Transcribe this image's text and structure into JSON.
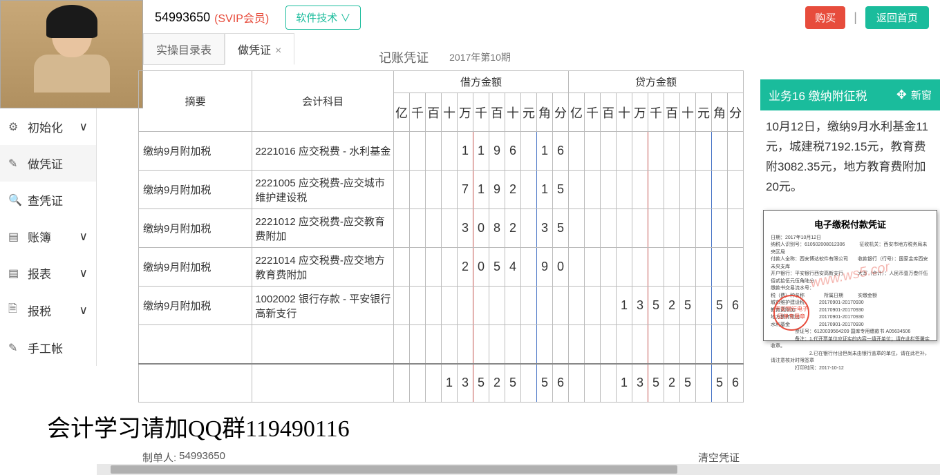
{
  "header": {
    "user_id": "54993650",
    "svip_label": "(SVIP会员)",
    "tech_btn": "软件技术 ∨",
    "buy_btn": "购买",
    "home_btn": "返回首页"
  },
  "sidebar": {
    "items": [
      {
        "icon": "⚙",
        "label": "初始化",
        "chev": "∨"
      },
      {
        "icon": "✎",
        "label": "做凭证",
        "chev": ""
      },
      {
        "icon": "🔍",
        "label": "查凭证",
        "chev": ""
      },
      {
        "icon": "▤",
        "label": "账簿",
        "chev": "∨"
      },
      {
        "icon": "▤",
        "label": "报表",
        "chev": "∨"
      },
      {
        "icon": "🗎",
        "label": "报税",
        "chev": "∨"
      },
      {
        "icon": "✎",
        "label": "手工帐",
        "chev": ""
      }
    ]
  },
  "tabs": [
    {
      "label": "实操目录表",
      "closable": false,
      "active": false
    },
    {
      "label": "做凭证",
      "closable": true,
      "active": true
    }
  ],
  "page_header": {
    "title": "记账凭证",
    "period": "2017年第10期"
  },
  "table": {
    "col_summary": "摘要",
    "col_account": "会计科目",
    "col_debit": "借方金额",
    "col_credit": "贷方金额",
    "units": [
      "亿",
      "千",
      "百",
      "十",
      "万",
      "千",
      "百",
      "十",
      "元",
      "角",
      "分"
    ],
    "rows": [
      {
        "summary": "缴纳9月附加税",
        "account": "2221016 应交税费 - 水利基金",
        "debit": "    1196 16",
        "credit": "           "
      },
      {
        "summary": "缴纳9月附加税",
        "account": "2221005 应交税费-应交城市维护建设税",
        "debit": "    7192 15",
        "credit": "           "
      },
      {
        "summary": "缴纳9月附加税",
        "account": "2221012 应交税费-应交教育费附加",
        "debit": "    3082 35",
        "credit": "           "
      },
      {
        "summary": "缴纳9月附加税",
        "account": "2221014 应交税费-应交地方教育费附加",
        "debit": "    2054 90",
        "credit": "           "
      },
      {
        "summary": "缴纳9月附加税",
        "account": "1002002 银行存款 - 平安银行高新支行",
        "debit": "           ",
        "credit": "   13525 56"
      },
      {
        "summary": "",
        "account": "",
        "debit": "           ",
        "credit": "           "
      }
    ],
    "total": {
      "debit": "   13525 56",
      "credit": "   13525 56"
    }
  },
  "footer": {
    "maker_label": "制单人:",
    "maker_value": "54993650",
    "clear": "清空凭证"
  },
  "right_panel": {
    "title": "业务16 缴纳附征税",
    "new_window": "新窗",
    "desc": "10月12日，缴纳9月水利基金11元，城建税7192.15元，教育费附3082.35元，地方教育费附加20元。",
    "receipt_title": "电子缴税付款凭证",
    "receipt_date": "日期：2017年10月12日",
    "stamp": "平安银行电子回单专用章",
    "watermark": "www.ws5.cor"
  },
  "overlay": "会计学习请加QQ群119490116"
}
